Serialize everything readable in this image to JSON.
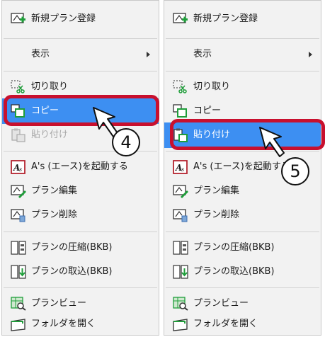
{
  "menus": [
    {
      "items": [
        {
          "label": "新規プラン登録"
        },
        {
          "label": "表示"
        },
        {
          "label": "切り取り"
        },
        {
          "label": "コピー"
        },
        {
          "label": "貼り付け"
        },
        {
          "label": "A's (エース)を起動する"
        },
        {
          "label": "プラン編集"
        },
        {
          "label": "プラン削除"
        },
        {
          "label": "プランの圧縮(BKB)"
        },
        {
          "label": "プランの取込(BKB)"
        },
        {
          "label": "プランビュー"
        },
        {
          "label": "フォルダを開く"
        }
      ],
      "step": "4"
    },
    {
      "items": [
        {
          "label": "新規プラン登録"
        },
        {
          "label": "表示"
        },
        {
          "label": "切り取り"
        },
        {
          "label": "コピー"
        },
        {
          "label": "貼り付け"
        },
        {
          "label": "A's (エース)を起動する"
        },
        {
          "label": "プラン編集"
        },
        {
          "label": "プラン削除"
        },
        {
          "label": "プランの圧縮(BKB)"
        },
        {
          "label": "プランの取込(BKB)"
        },
        {
          "label": "プランビュー"
        },
        {
          "label": "フォルダを開く"
        }
      ],
      "step": "5"
    }
  ],
  "colors": {
    "highlight": "#3d8ff2",
    "callout_border": "#c8102e",
    "icon_green": "#1f9e3a"
  }
}
